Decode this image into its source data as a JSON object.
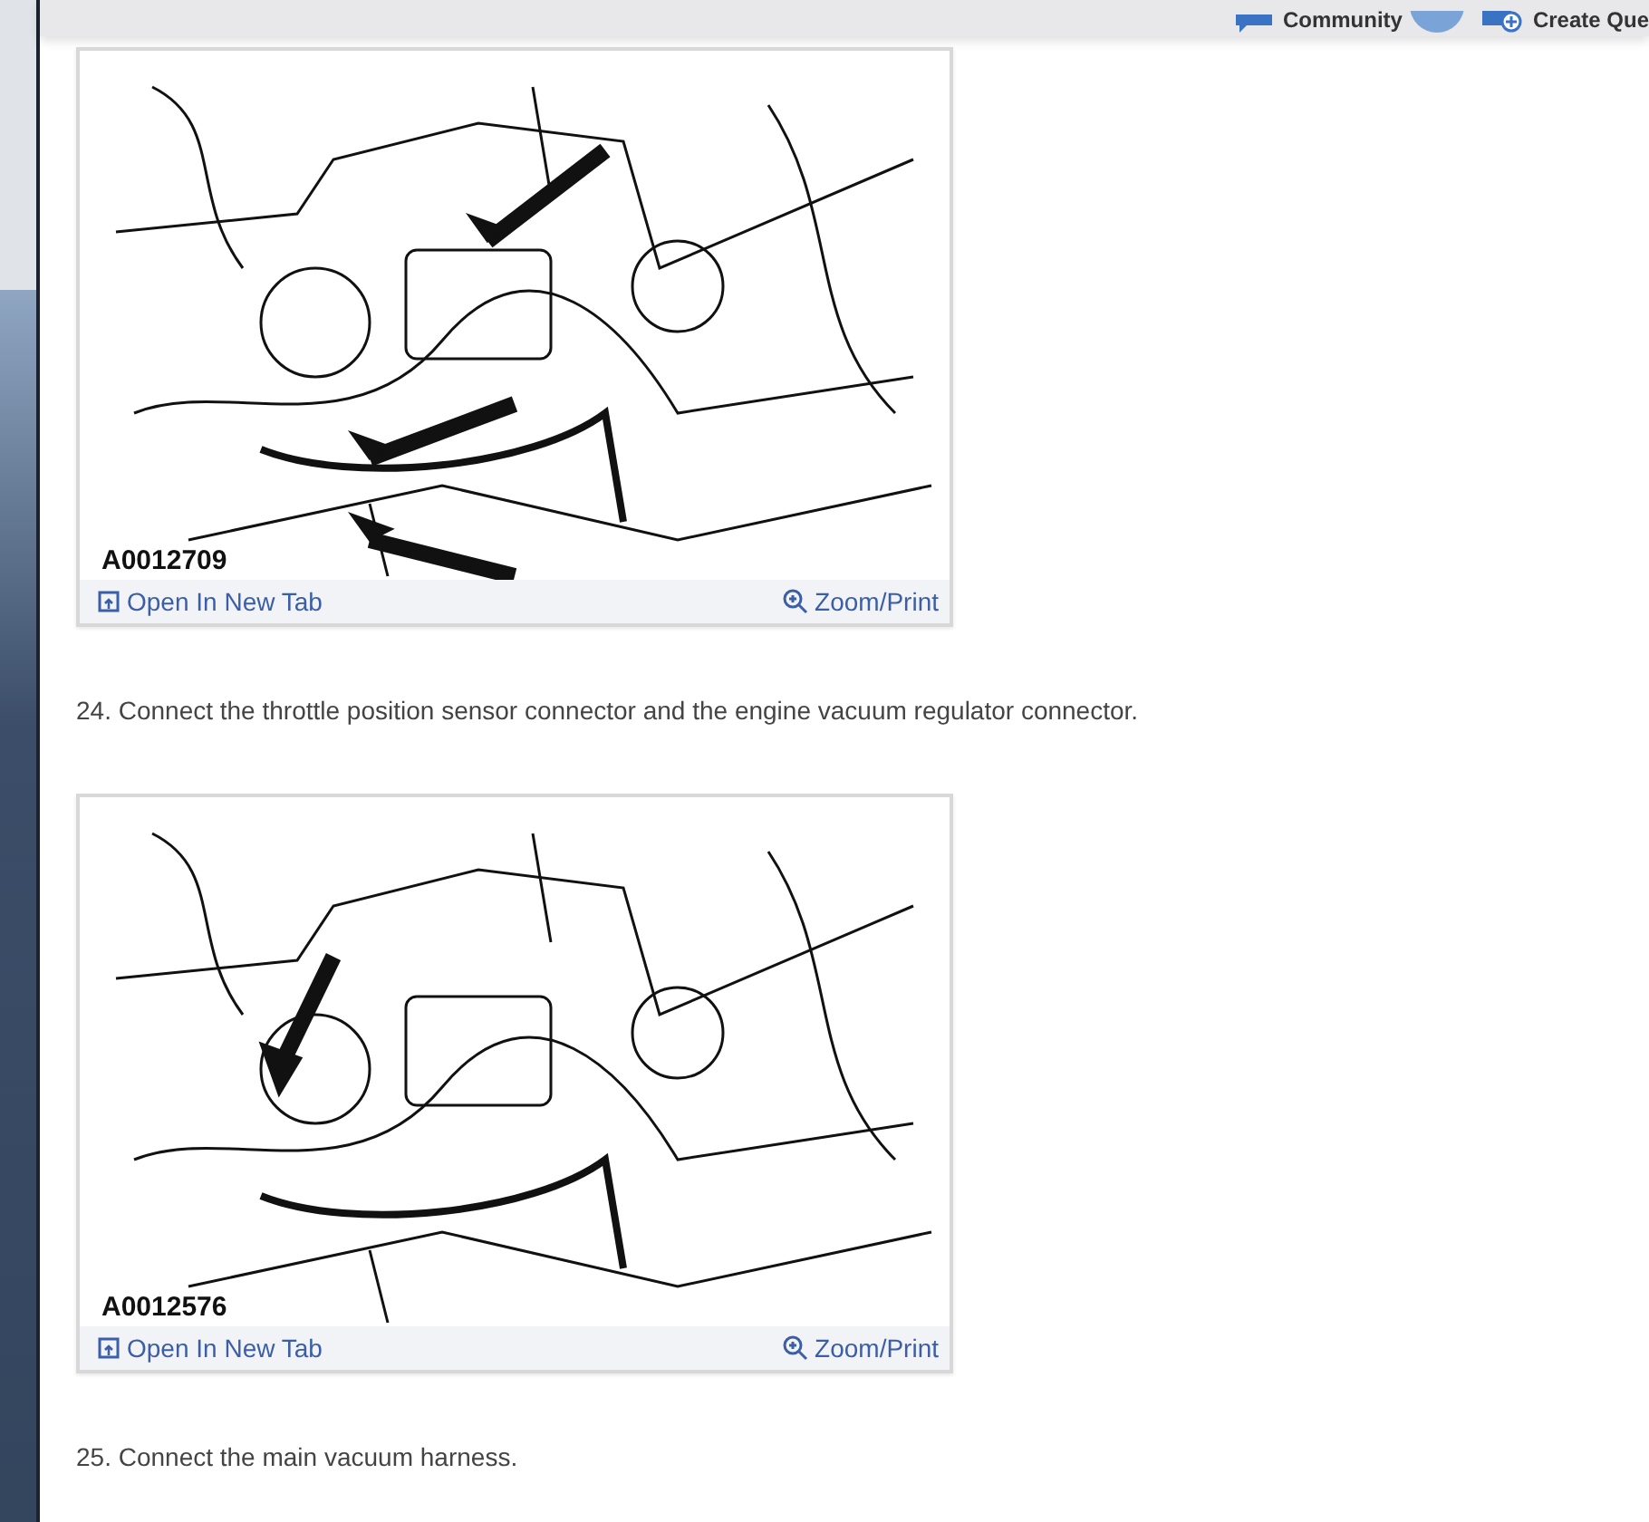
{
  "header": {
    "community": "Community",
    "create": "Create Que"
  },
  "content": [
    {
      "kind": "figure",
      "label": "A0012709",
      "open_link": "Open In New Tab",
      "zoom_link": "Zoom/Print"
    },
    {
      "kind": "step",
      "text": "24. Connect the throttle position sensor connector and the engine vacuum regulator connector."
    },
    {
      "kind": "figure",
      "label": "A0012576",
      "open_link": "Open In New Tab",
      "zoom_link": "Zoom/Print"
    },
    {
      "kind": "step",
      "text": "25. Connect the main vacuum harness."
    }
  ]
}
